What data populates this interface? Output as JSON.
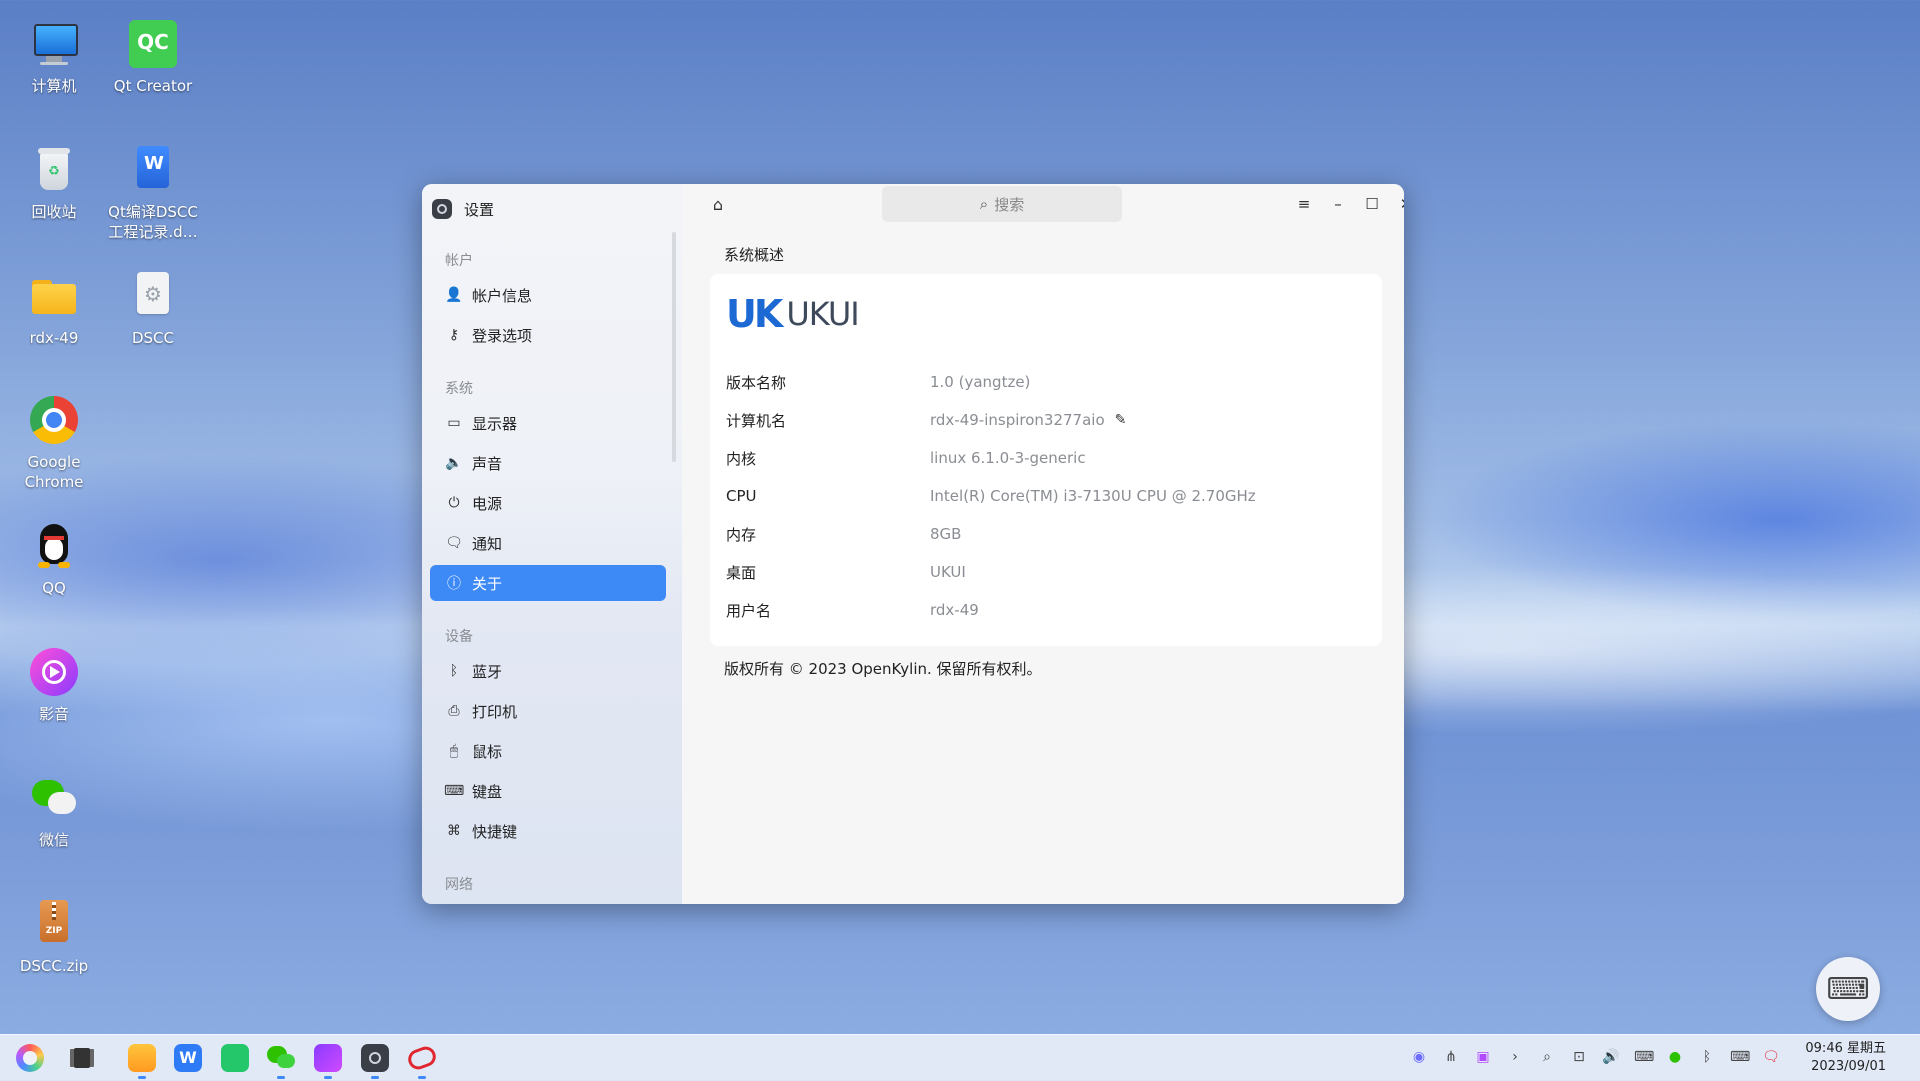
{
  "desktop": {
    "icons": [
      {
        "label": "计算机"
      },
      {
        "label": "Qt Creator",
        "badge": "QC"
      },
      {
        "label": "回收站"
      },
      {
        "label": "Qt编译DSCC工程记录.d…"
      },
      {
        "label": "rdx-49"
      },
      {
        "label": "DSCC"
      },
      {
        "label": "Google Chrome"
      },
      {
        "label": "QQ"
      },
      {
        "label": "影音"
      },
      {
        "label": "微信"
      },
      {
        "label": "DSCC.zip",
        "badge": "ZIP"
      }
    ]
  },
  "window": {
    "title": "设置",
    "search_placeholder": "搜索",
    "sidebar": {
      "groups": [
        {
          "label": "帐户",
          "items": [
            {
              "label": "帐户信息"
            },
            {
              "label": "登录选项"
            }
          ]
        },
        {
          "label": "系统",
          "items": [
            {
              "label": "显示器"
            },
            {
              "label": "声音"
            },
            {
              "label": "电源"
            },
            {
              "label": "通知"
            },
            {
              "label": "关于"
            }
          ]
        },
        {
          "label": "设备",
          "items": [
            {
              "label": "蓝牙"
            },
            {
              "label": "打印机"
            },
            {
              "label": "鼠标"
            },
            {
              "label": "键盘"
            },
            {
              "label": "快捷键"
            }
          ]
        },
        {
          "label": "网络",
          "items": []
        }
      ],
      "active": "关于"
    },
    "content": {
      "section_title": "系统概述",
      "logo_text": "UKUI",
      "rows": [
        {
          "key": "版本名称",
          "value": "1.0 (yangtze)"
        },
        {
          "key": "计算机名",
          "value": "rdx-49-inspiron3277aio"
        },
        {
          "key": "内核",
          "value": "linux 6.1.0-3-generic"
        },
        {
          "key": "CPU",
          "value": "Intel(R) Core(TM) i3-7130U CPU @ 2.70GHz"
        },
        {
          "key": "内存",
          "value": "8GB"
        },
        {
          "key": "桌面",
          "value": "UKUI"
        },
        {
          "key": "用户名",
          "value": "rdx-49"
        }
      ],
      "copyright": "版权所有 © 2023 OpenKylin. 保留所有权利。"
    }
  },
  "taskbar": {
    "time": "09:46 星期五",
    "date": "2023/09/01"
  },
  "colors": {
    "accent": "#3d8af7",
    "ukui_blue": "#1c69d4"
  }
}
